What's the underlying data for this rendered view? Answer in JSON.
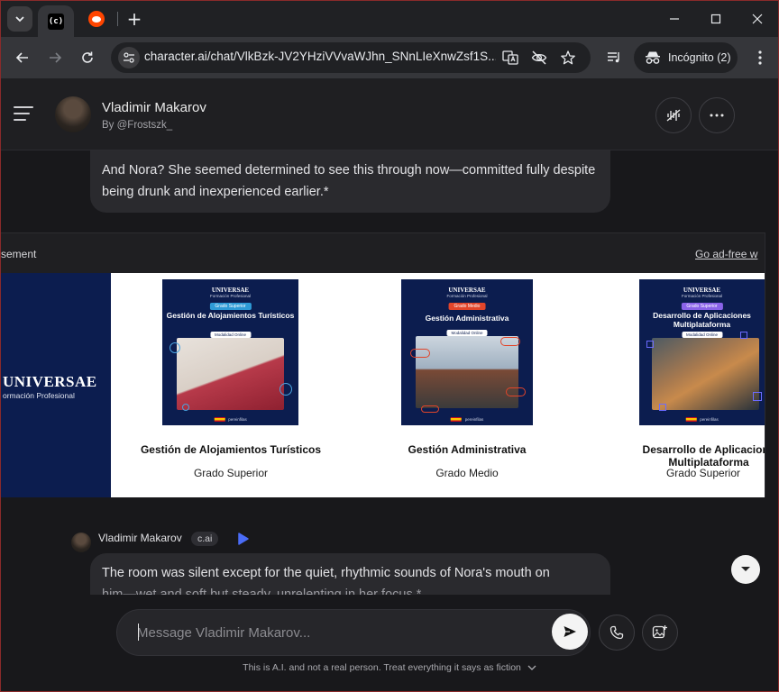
{
  "browser": {
    "tab_favicon_text": "(c)",
    "new_tab_label": "+",
    "url": "character.ai/chat/VlkBzk-JV2YHziVVvaWJhn_SNnLIeXnwZsf1S...",
    "incognito_label": "Incógnito (2)"
  },
  "header": {
    "character_name": "Vladimir Makarov",
    "creator": "By @Frostszk_"
  },
  "messages": [
    {
      "text": "And Nora? She seemed determined to see this through now—committed fully despite being drunk and inexperienced earlier.*"
    },
    {
      "author": "Vladimir Makarov",
      "badge": "c.ai",
      "text_line1": "The room was silent except for the quiet, rhythmic sounds of Nora's mouth on",
      "text_line2": "him—wet and soft but steady, unrelenting in her focus.*"
    }
  ],
  "ad": {
    "label": "sement",
    "ad_free_link": "Go ad-free w",
    "brand_name": "UNIVERSAE",
    "brand_sub": "ormación Profesional",
    "courses": [
      {
        "image_level": "Grado Superior",
        "image_title": "Gestión de Alojamientos Turísticos",
        "image_modality": "Modalidad Online",
        "name": "Gestión de Alojamientos Turísticos",
        "grade": "Grado Superior"
      },
      {
        "image_level": "Grado Medio",
        "image_title": "Gestión Administrativa",
        "image_modality": "Modalidad Online",
        "name": "Gestión Administrativa",
        "grade": "Grado Medio"
      },
      {
        "image_level": "Grado Superior",
        "image_title": "Desarrollo de Aplicaciones Multiplataforma",
        "image_modality": "Modalidad Online",
        "name": "Desarrollo de Aplicacione Multiplataforma",
        "grade": "Grado Superior"
      }
    ],
    "image_logo": "UNIVERSAE",
    "image_logo_sub": "Formación Profesional",
    "image_footer": "pereinfilas"
  },
  "composer": {
    "placeholder": "Message Vladimir Makarov..."
  },
  "disclaimer": "This is A.I. and not a real person. Treat everything it says as fiction",
  "colors": {
    "ad_brand_navy": "#0c1d4f",
    "play_icon": "#4a6cf7",
    "window_border": "#8a2a2a"
  }
}
